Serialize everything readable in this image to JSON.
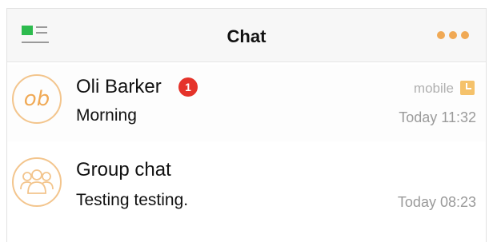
{
  "header": {
    "title": "Chat",
    "menu_icon": "sidebar-menu-icon",
    "more_icon": "more-options-icon"
  },
  "colors": {
    "accent": "#f0a955",
    "menu_green": "#2dbb4e",
    "badge_red": "#e5332a"
  },
  "chats": [
    {
      "name": "Oli Barker",
      "initials": "ob",
      "unread": "1",
      "preview": "Morning",
      "device": "mobile",
      "time": "Today 11:32"
    },
    {
      "name": "Group chat",
      "preview": "Testing testing.",
      "time": "Today 08:23",
      "avatar_icon": "group-icon"
    }
  ]
}
